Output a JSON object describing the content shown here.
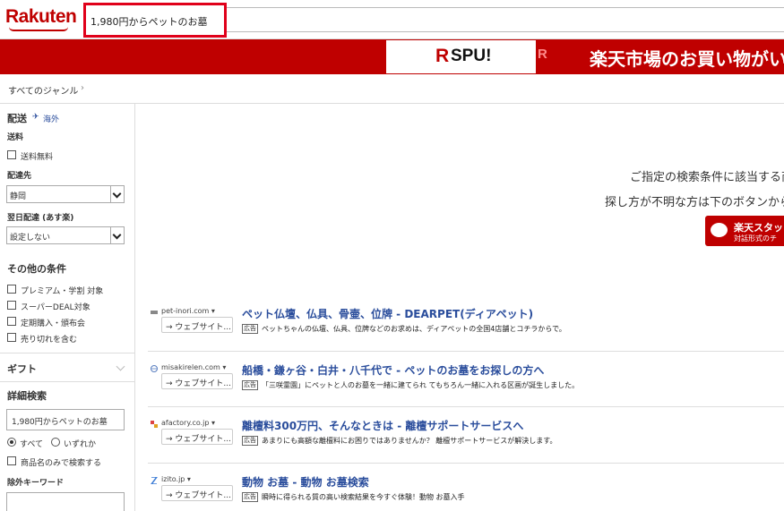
{
  "header": {
    "logo": "Rakuten",
    "search_value": "1,980円からペットのお墓"
  },
  "banner": {
    "spu_icon": "R",
    "spu_label": "SPU!",
    "mini_icon": "R",
    "text": "楽天市場のお買い物がい"
  },
  "breadcrumb": {
    "label": "すべてのジャンル",
    "chevron": "›"
  },
  "sidebar": {
    "delivery": {
      "title": "配送",
      "overseas_icon": "✈",
      "overseas_label": "海外",
      "shipping_label": "送料",
      "free_shipping": "送料無料",
      "destination_label": "配達先",
      "destination_value": "静岡",
      "next_day_label": "翌日配達 (あす楽)",
      "next_day_value": "設定しない"
    },
    "other": {
      "title": "その他の条件",
      "options": [
        "プレミアム・学割 対象",
        "スーパーDEAL対象",
        "定期購入・頒布会",
        "売り切れを含む"
      ]
    },
    "gift": {
      "title": "ギフト"
    },
    "advanced": {
      "title": "詳細検索",
      "keyword_value": "1,980円からペットのお墓",
      "radio_all": "すべて",
      "radio_any": "いずれか",
      "name_only": "商品名のみで検索する",
      "exclude_label": "除外キーワード"
    }
  },
  "main": {
    "no_result_line1": "ご指定の検索条件に該当する商",
    "no_result_line2": "探し方が不明な方は下のボタンから",
    "staff_button_line1": "楽天スタッフ",
    "staff_button_line2": "対話形式のチ",
    "ads": [
      {
        "domain": "pet-inori.com ▾",
        "web_label": "→ ウェブサイト...",
        "title": "ペット仏壇、仏具、骨壷、位牌 - DEARPET(ディアペット)",
        "badge": "広告",
        "desc": "ペットちゃんの仏壇、仏具、位牌などのお求めは、ディアペットの全国4店舗とコチラからで。"
      },
      {
        "domain": "misakirelen.com ▾",
        "web_label": "→ ウェブサイト...",
        "title": "船橋・鎌ヶ谷・白井・八千代で - ペットのお墓をお探しの方へ",
        "badge": "広告",
        "desc": "「三咲霊園」にペットと人のお墓を一緒に建てられ てもちろん一緒に入れる区画が誕生しました。"
      },
      {
        "domain": "afactory.co.jp ▾",
        "web_label": "→ ウェブサイト...",
        "title": "離檀料300万円、そんなときは - 離檀サポートサービスへ",
        "badge": "広告",
        "desc": "あまりにも高額な離檀料にお困りではありませんか？ 離檀サポートサービスが解決します。"
      },
      {
        "domain": "izito.jp ▾",
        "web_label": "→ ウェブサイト...",
        "title": "動物 お墓 - 動物 お墓検索",
        "badge": "広告",
        "desc": "瞬時に得られる質の高い検索結果を今すぐ体験！動物 お墓入手"
      }
    ]
  },
  "colors": {
    "brand_red": "#bf0000",
    "search_border": "#e0001a",
    "ad_title": "#2a4d9c"
  }
}
